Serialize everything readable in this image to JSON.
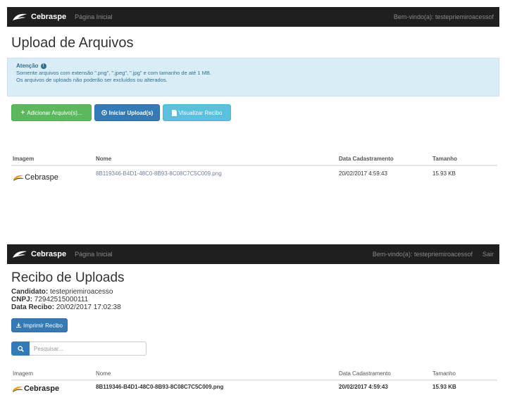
{
  "nav1": {
    "brand": "Cebraspe",
    "link": "Página Inicial",
    "welcome": "Bem-vindo(a): testepriemiroacessof"
  },
  "upload": {
    "title": "Upload de Arquivos",
    "alert_title": "Atenção",
    "alert_line1": "Somente arquivos com extensão \".png\", \".jpeg\", \".jpg\" e com tamanho de até 1 MB.",
    "alert_line2": "Os arquivos de uploads não poderão ser excluídos ou alterados.",
    "btn_add": "Adicionar Arquivo(s)...",
    "btn_start": "Iniciar Upload(s)",
    "btn_receipt": "Visualizar Recibo",
    "table": {
      "headers": [
        "Imagem",
        "Nome",
        "Data Cadastramento",
        "Tamanho"
      ],
      "rows": [
        {
          "name": "8B119346-B4D1-48C0-8B93-8C08C7C5C009.png",
          "date": "20/02/2017 4:59:43",
          "size": "15.93 KB"
        }
      ]
    }
  },
  "nav2": {
    "brand": "Cebraspe",
    "link": "Página Inicial",
    "welcome": "Bem-vindo(a): testepriemiroacessof",
    "exit": "Sair"
  },
  "receipt": {
    "title": "Recibo de Uploads",
    "candidate_label": "Candidato:",
    "candidate_value": "testepriemiroacesso",
    "cnpj_label": "CNPJ:",
    "cnpj_value": "72942515000111",
    "date_label": "Data Recibo:",
    "date_value": "20/02/2017 17:02:38",
    "btn_print": "Imprimir Recibo",
    "search_placeholder": "Pesquisar...",
    "table": {
      "headers": [
        "Imagem",
        "Nome",
        "Data Cadastramento",
        "Tamanho"
      ],
      "rows": [
        {
          "name": "8B119346-B4D1-48C0-8B93-8C08C7C5C009.png",
          "date": "20/02/2017 4:59:43",
          "size": "15.93 KB"
        }
      ]
    }
  },
  "logo_text": "Cebraspe",
  "colors": {
    "navbar": "#1f1f1f",
    "alert_bg": "#d9edf7",
    "success": "#5cb85c",
    "primary": "#337ab7",
    "info": "#5bc0de"
  },
  "icons": [
    "cebraspe-logo-icon",
    "info-icon",
    "plus-icon",
    "upload-circle-icon",
    "file-icon",
    "print-icon",
    "search-icon"
  ]
}
